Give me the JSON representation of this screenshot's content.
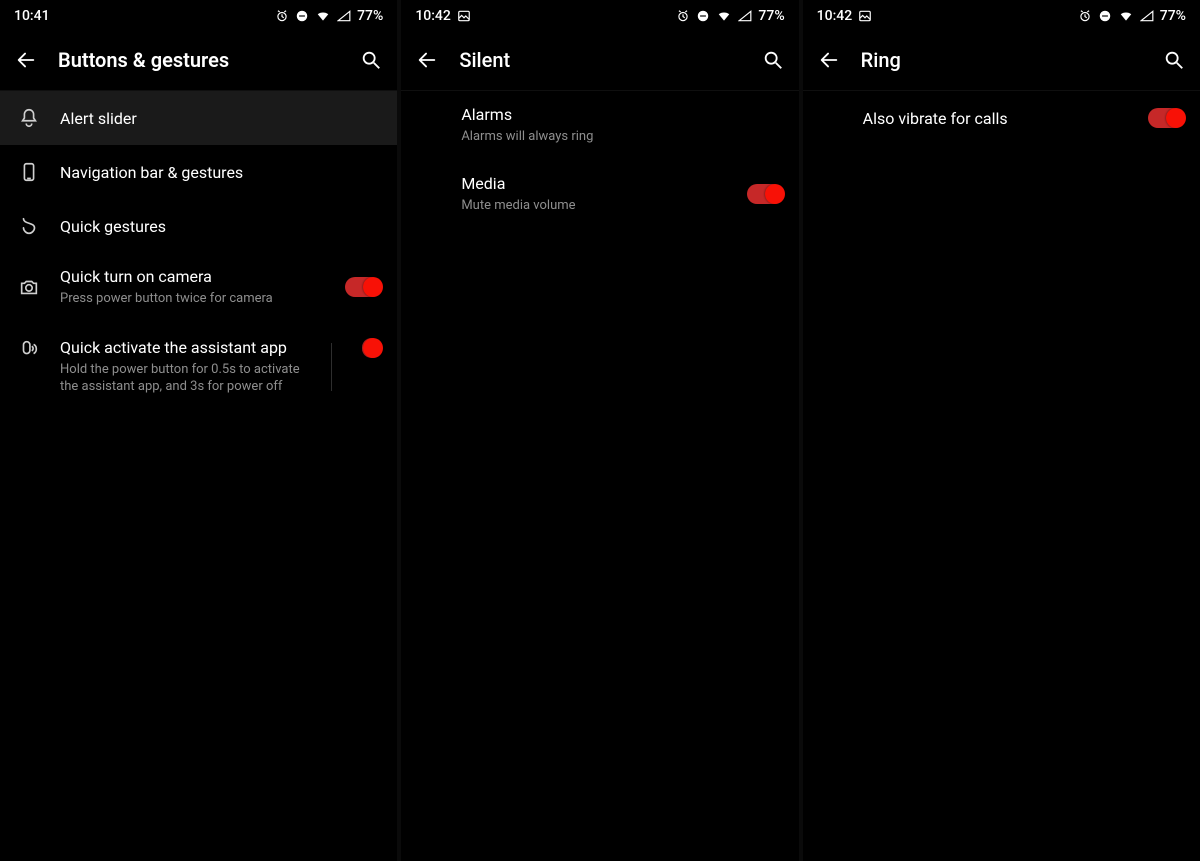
{
  "status": {
    "battery_pct": "77%",
    "time1": "10:41",
    "time2": "10:42",
    "time3": "10:42"
  },
  "colors": {
    "accent": "#f81106",
    "track": "#c62828"
  },
  "screen1": {
    "title": "Buttons & gestures",
    "items": [
      {
        "icon": "bell-slider",
        "label": "Alert slider",
        "sub": "",
        "toggle": null,
        "selected": true
      },
      {
        "icon": "phone-rect",
        "label": "Navigation bar & gestures",
        "sub": "",
        "toggle": null
      },
      {
        "icon": "gesture",
        "label": "Quick gestures",
        "sub": "",
        "toggle": null
      },
      {
        "icon": "camera",
        "label": "Quick turn on camera",
        "sub": "Press power button twice for camera",
        "toggle": true
      },
      {
        "icon": "assistant",
        "label": "Quick activate the assistant app",
        "sub": "Hold the power button for 0.5s to activate the assistant app, and 3s for power off",
        "toggle": true,
        "divider": true
      }
    ]
  },
  "screen2": {
    "title": "Silent",
    "items": [
      {
        "label": "Alarms",
        "sub": "Alarms will always ring",
        "toggle": null
      },
      {
        "label": "Media",
        "sub": "Mute media volume",
        "toggle": true
      }
    ]
  },
  "screen3": {
    "title": "Ring",
    "items": [
      {
        "label": "Also vibrate for calls",
        "sub": "",
        "toggle": true
      }
    ]
  }
}
